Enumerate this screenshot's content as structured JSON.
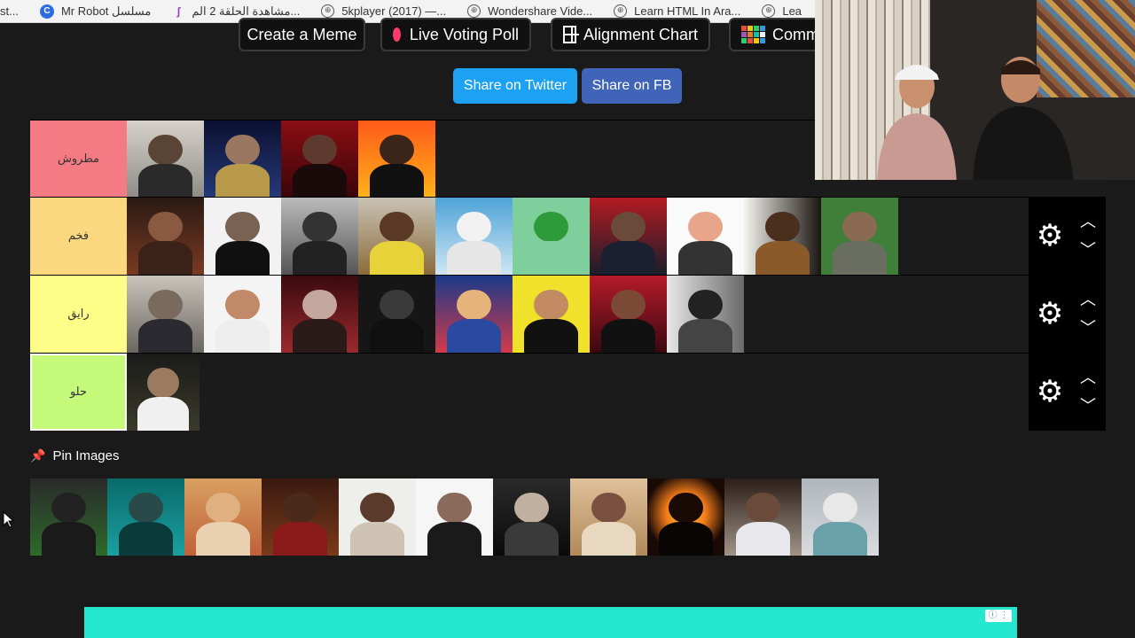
{
  "bookmarks": [
    {
      "label": "st...",
      "icon": "none"
    },
    {
      "label": "Mr Robot مسلسل",
      "icon": "c-logo-icon"
    },
    {
      "label": "مشاهدة الحلقة 2 الم...",
      "icon": "s-logo-icon"
    },
    {
      "label": "5kplayer (2017) —...",
      "icon": "globe-icon"
    },
    {
      "label": "Wondershare Vide...",
      "icon": "globe-icon"
    },
    {
      "label": "Learn HTML In Ara...",
      "icon": "globe-icon"
    },
    {
      "label": "Lea",
      "icon": "globe-icon"
    }
  ],
  "toolbar": {
    "create_meme": "Create a Meme",
    "live_poll": "Live Voting Poll",
    "alignment": "Alignment Chart",
    "community": "Comm"
  },
  "share": {
    "twitter": "Share on Twitter",
    "fb": "Share on FB"
  },
  "colors": {
    "twitter": "#1da1f2",
    "fb": "#3f64b8",
    "tier1": "#f47b84",
    "tier2": "#fbd880",
    "tier3": "#fdfd87",
    "tier4": "#c5f97a"
  },
  "tiers": [
    {
      "label": "مطروش",
      "color": "#f47b84",
      "tile_count": 4
    },
    {
      "label": "فخم",
      "color": "#fbd880",
      "tile_count": 10
    },
    {
      "label": "رايق",
      "color": "#fdfd87",
      "tile_count": 8
    },
    {
      "label": "حلو",
      "color": "#c5f97a",
      "tile_count": 1
    }
  ],
  "pin": {
    "title": "Pin Images",
    "tile_count": 11
  }
}
